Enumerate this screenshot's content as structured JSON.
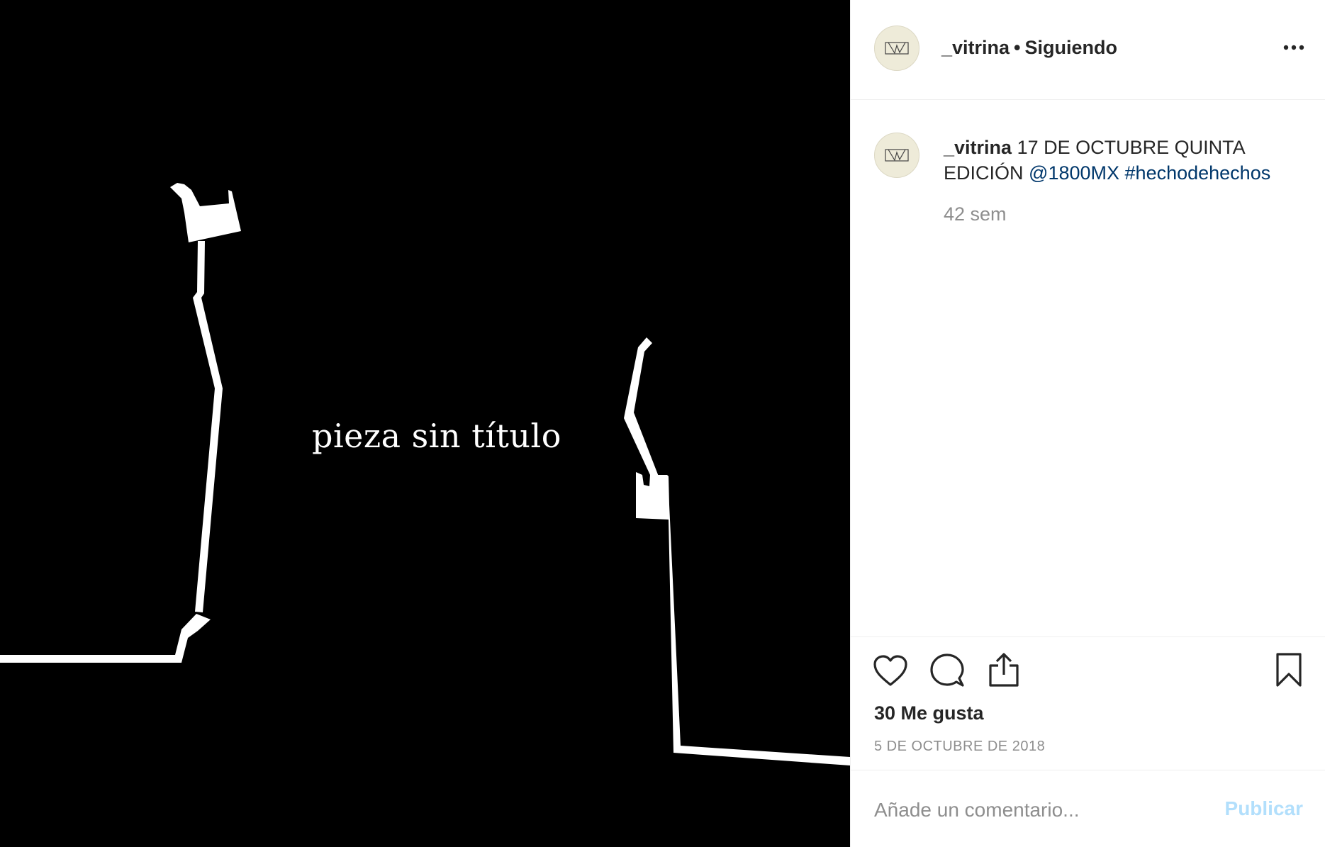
{
  "media": {
    "art_text": "pieza sin título",
    "background_color": "#000000"
  },
  "header": {
    "username": "_vitrina",
    "separator": "•",
    "follow_status": "Siguiendo",
    "more_icon": "ellipsis-icon"
  },
  "caption": {
    "username": "_vitrina",
    "text": "17 DE OCTUBRE QUINTA EDICIÓN",
    "mention": "@1800MX",
    "hashtag": "#hechodehechos",
    "time_ago": "42 sem"
  },
  "actions": {
    "icons": [
      "heart-icon",
      "comment-icon",
      "share-icon",
      "bookmark-icon"
    ],
    "likes": "30 Me gusta",
    "date": "5 DE OCTUBRE DE 2018"
  },
  "comment": {
    "placeholder": "Añade un comentario...",
    "publish_label": "Publicar"
  },
  "colors": {
    "text": "#262626",
    "secondary": "#8e8e8e",
    "link": "#00376b",
    "publish_disabled": "#b2dffc",
    "avatar_bg": "#eeebd9"
  }
}
